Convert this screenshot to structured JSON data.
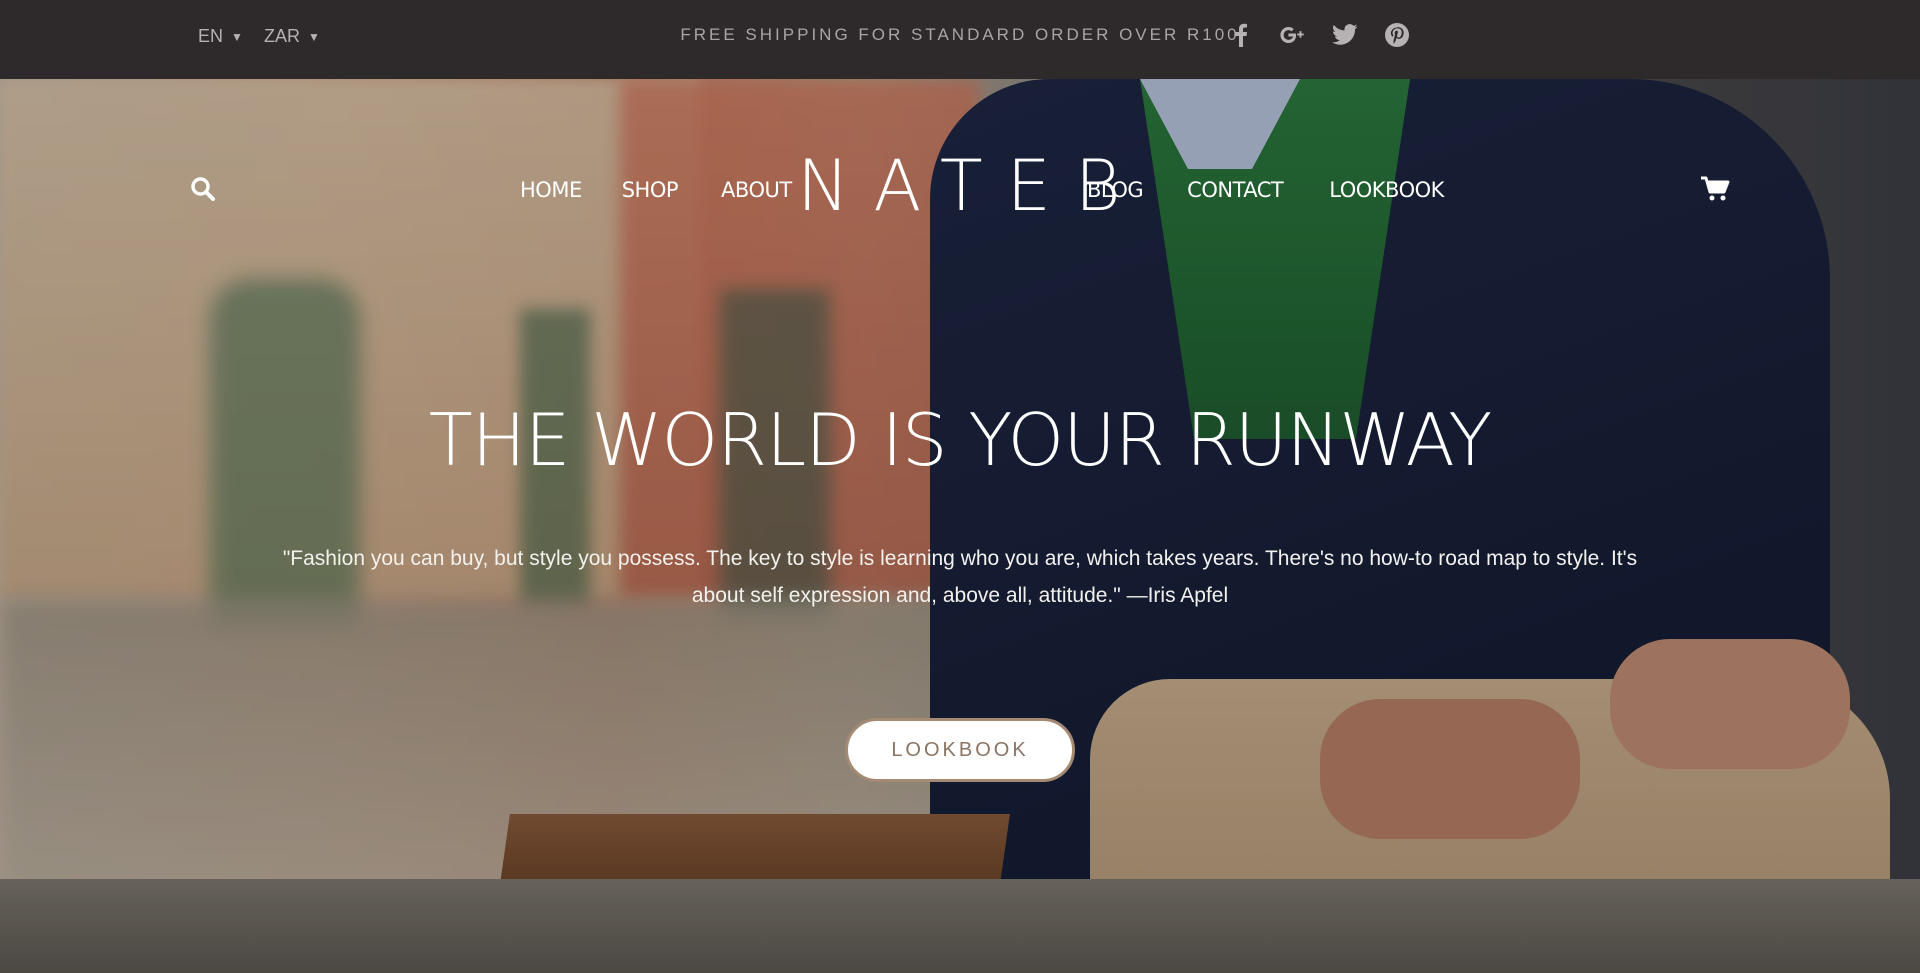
{
  "topbar": {
    "language": "EN",
    "currency": "ZAR",
    "shipping_notice": "FREE SHIPPING FOR STANDARD ORDER OVER R100",
    "social_icons": [
      "facebook-icon",
      "google-plus-icon",
      "twitter-icon",
      "pinterest-icon"
    ]
  },
  "nav": {
    "left": [
      "HOME",
      "SHOP",
      "ABOUT"
    ],
    "logo": "NATEB",
    "right": [
      "BLOG",
      "CONTACT",
      "LOOKBOOK"
    ]
  },
  "hero": {
    "headline": "THE WORLD IS YOUR RUNWAY",
    "quote": "\"Fashion you can buy, but style you possess. The key to style is learning who you are, which takes years. There's no how-to road map to style. It's about self expression and, above all, attitude.\" —Iris Apfel",
    "cta_label": "LOOKBOOK"
  },
  "colors": {
    "topbar_bg": "#2e2a2b",
    "cta_border": "#a58a73",
    "cta_text": "#8b7463"
  }
}
